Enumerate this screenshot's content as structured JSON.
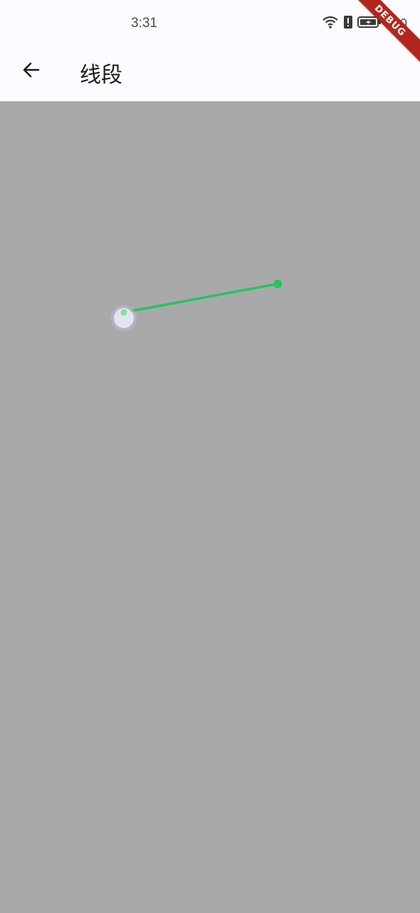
{
  "status_bar": {
    "time": "3:31",
    "battery_text": "100",
    "icons": [
      "wifi-icon",
      "alert-icon",
      "battery-charging-icon"
    ]
  },
  "app_bar": {
    "back_icon": "arrow-back-icon",
    "title": "线段"
  },
  "canvas": {
    "background": "#a9a9a9",
    "segment_color": "#22c55e",
    "handle_color": "#e8e8ee"
  },
  "debug_banner": {
    "label": "DEBUG",
    "color": "#b3261e"
  }
}
